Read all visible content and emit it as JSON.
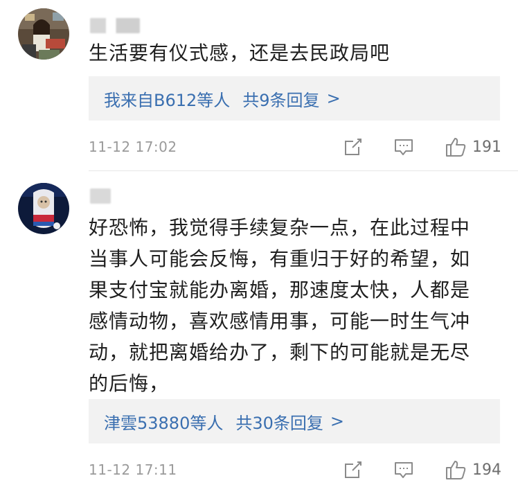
{
  "comments": [
    {
      "text": "生活要有仪式感，还是去民政局吧",
      "replies": {
        "from": "我来自B612等人",
        "count": "共9条回复",
        "chevron": ">"
      },
      "time": "11-12 17:02",
      "likes": "191"
    },
    {
      "text": "好恐怖，我觉得手续复杂一点，在此过程中\n当事人可能会反悔，有重归于好的希望，如\n果支付宝就能办离婚，那速度太快，人都是\n感情动物，喜欢感情用事，可能一时生气冲\n动，就把离婚给办了，剩下的可能就是无尽\n的后悔，",
      "replies": {
        "from": "津雲53880等人",
        "count": "共30条回复",
        "chevron": ">"
      },
      "time": "11-12 17:11",
      "likes": "194"
    }
  ],
  "icons": {
    "share": "share-icon",
    "reply": "reply-icon",
    "like": "thumbs-up-icon"
  },
  "colors": {
    "link": "#3a6fb0",
    "reply_bg": "#f2f2f2",
    "meta": "#9a9a9a"
  }
}
